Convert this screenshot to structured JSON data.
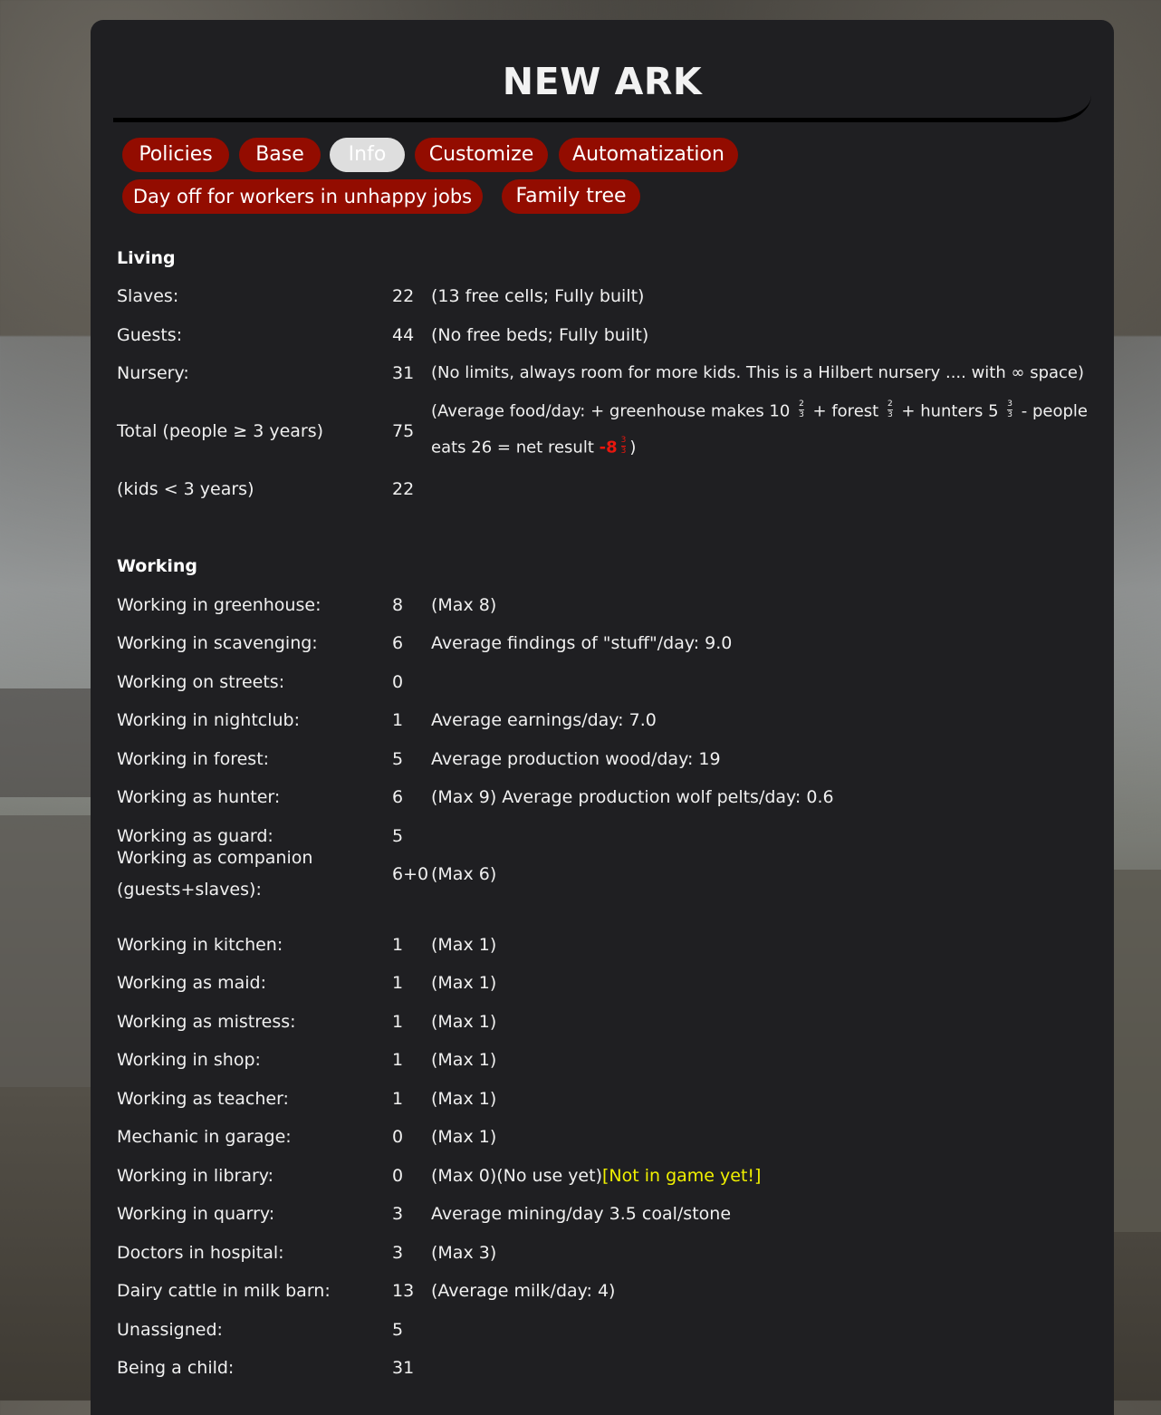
{
  "title": "NEW ARK",
  "tabs": {
    "policies": "Policies",
    "base": "Base",
    "info": "Info",
    "customize": "Customize",
    "automatization": "Automatization",
    "day_off": "Day off for workers in unhappy jobs",
    "family_tree": "Family tree"
  },
  "living": {
    "heading": "Living",
    "slaves": {
      "label": "Slaves:",
      "value": "22",
      "note": "(13 free cells; Fully built)"
    },
    "guests": {
      "label": "Guests:",
      "value": "44",
      "note": "(No free beds; Fully built)"
    },
    "nursery": {
      "label": "Nursery:",
      "value": "31",
      "note": "(No limits, always room for more kids. This is a Hilbert nursery .... with ∞ space)"
    },
    "total": {
      "label": "Total (people ≥ 3 years)",
      "value": "75",
      "food_a": "(Average food/day: + greenhouse makes 10",
      "food_b": "+ forest",
      "food_c": "+ hunters 5",
      "food_d": "- people",
      "food_e": "eats 26 = net result",
      "net": "-8",
      "close": ")",
      "frac_greenhouse": [
        "2",
        "3"
      ],
      "frac_forest": [
        "2",
        "3"
      ],
      "frac_hunters": [
        "3",
        "3"
      ],
      "frac_net": [
        "3",
        "3"
      ]
    },
    "kids": {
      "label": "(kids < 3 years)",
      "value": "22"
    }
  },
  "working": {
    "heading": "Working",
    "rows": [
      {
        "label": "Working in greenhouse:",
        "value": "8",
        "note": "(Max 8)"
      },
      {
        "label": "Working in scavenging:",
        "value": "6",
        "note": "Average findings of \"stuff\"/day: 9.0"
      },
      {
        "label": "Working on streets:",
        "value": "0",
        "note": ""
      },
      {
        "label": "Working in nightclub:",
        "value": "1",
        "note": "Average earnings/day: 7.0"
      },
      {
        "label": "Working in forest:",
        "value": "5",
        "note": "Average production wood/day: 19"
      },
      {
        "label": "Working as hunter:",
        "value": "6",
        "note": "(Max 9) Average production wolf pelts/day: 0.6"
      },
      {
        "label": "Working as guard:",
        "value": "5",
        "note": ""
      },
      {
        "label_a": "Working as companion",
        "label_b": "(guests+slaves):",
        "value": "6+0",
        "note": "(Max 6)"
      },
      {
        "label": "Working in kitchen:",
        "value": "1",
        "note": "(Max 1)"
      },
      {
        "label": "Working as maid:",
        "value": "1",
        "note": "(Max 1)"
      },
      {
        "label": "Working as mistress:",
        "value": "1",
        "note": "(Max 1)"
      },
      {
        "label": "Working in shop:",
        "value": "1",
        "note": "(Max 1)"
      },
      {
        "label": "Working as teacher:",
        "value": "1",
        "note": "(Max 1)"
      },
      {
        "label": "Mechanic in garage:",
        "value": "0",
        "note": "(Max 1)"
      },
      {
        "label": "Working in library:",
        "value": "0",
        "note": "(Max 0)(No use yet)",
        "warning": "[Not in game yet!]"
      },
      {
        "label": "Working in quarry:",
        "value": "3",
        "note": "Average mining/day 3.5 coal/stone"
      },
      {
        "label": "Doctors in hospital:",
        "value": "3",
        "note": "(Max 3)"
      },
      {
        "label": "Dairy cattle in milk barn:",
        "value": "13",
        "note": "(Average milk/day: 4)"
      },
      {
        "label": "Unassigned:",
        "value": "5",
        "note": ""
      },
      {
        "label": "Being a child:",
        "value": "31",
        "note": ""
      }
    ]
  },
  "colors": {
    "panel": "#1f1f22",
    "tab": "#930c00",
    "tab_active": "#dedede",
    "warning": "#f0f000",
    "negative": "#e8170e"
  }
}
